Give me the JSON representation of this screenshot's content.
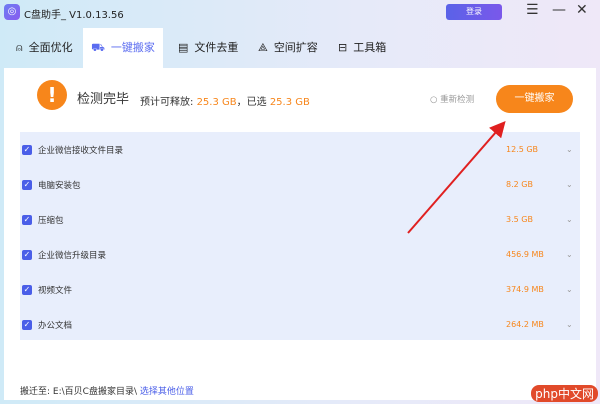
{
  "app": {
    "title": "C盘助手_ V1.0.13.56",
    "login": "登录"
  },
  "tabs": [
    {
      "label": "全面优化",
      "icon": "rocket-icon"
    },
    {
      "label": "一键搬家",
      "icon": "truck-icon"
    },
    {
      "label": "文件去重",
      "icon": "document-icon"
    },
    {
      "label": "空间扩容",
      "icon": "network-icon"
    },
    {
      "label": "工具箱",
      "icon": "toolbox-icon"
    }
  ],
  "scan": {
    "status": "检测完毕",
    "estimate_label": "预计可释放:",
    "estimate": "25.3 GB",
    "selected_label": "，已选",
    "selected": "25.3 GB",
    "recheck": "重新检测",
    "move_button": "一键搬家"
  },
  "items": [
    {
      "name": "企业微信接收文件目录",
      "size": "12.5 GB"
    },
    {
      "name": "电脑安装包",
      "size": "8.2 GB"
    },
    {
      "name": "压缩包",
      "size": "3.5 GB"
    },
    {
      "name": "企业微信升级目录",
      "size": "456.9 MB"
    },
    {
      "name": "视频文件",
      "size": "374.9 MB"
    },
    {
      "name": "办公文档",
      "size": "264.2 MB"
    }
  ],
  "footer": {
    "label": "搬迁至:",
    "path": "E:\\百贝C盘搬家目录\\",
    "link": "选择其他位置"
  },
  "watermark": "php中文网",
  "colors": {
    "accent": "#5b6cf0",
    "orange": "#f7861b"
  }
}
